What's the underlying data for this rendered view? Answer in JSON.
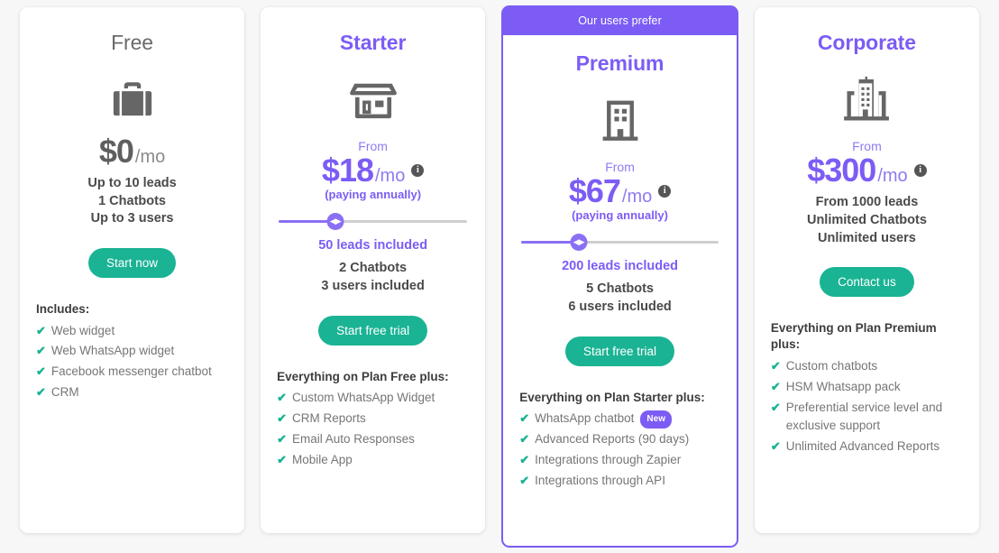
{
  "colors": {
    "purple": "#7c5cf5",
    "green": "#1ab394",
    "gray_text": "#767676",
    "page_bg": "#f7f7f7"
  },
  "plans": [
    {
      "name": "Free",
      "icon": "briefcase-icon",
      "from_label": "",
      "price_amount": "$0",
      "price_period": "/mo",
      "annually_note": "",
      "has_info_icon": false,
      "has_slider": false,
      "leads_included": "",
      "specs": [
        "Up to 10 leads",
        "1 Chatbots",
        "Up to 3 users"
      ],
      "cta_label": "Start now",
      "features_heading": "Includes:",
      "features": [
        {
          "text": "Web widget",
          "badge": ""
        },
        {
          "text": "Web WhatsApp widget",
          "badge": ""
        },
        {
          "text": "Facebook messenger chatbot",
          "badge": ""
        },
        {
          "text": "CRM",
          "badge": ""
        }
      ]
    },
    {
      "name": "Starter",
      "icon": "storefront-icon",
      "from_label": "From",
      "price_amount": "$18",
      "price_period": "/mo",
      "annually_note": "(paying annually)",
      "has_info_icon": true,
      "has_slider": true,
      "slider_percent": 30,
      "leads_included": "50 leads included",
      "specs": [
        "2 Chatbots",
        "3 users included"
      ],
      "cta_label": "Start free trial",
      "features_heading": "Everything on Plan Free plus:",
      "features": [
        {
          "text": "Custom WhatsApp Widget",
          "badge": ""
        },
        {
          "text": "CRM Reports",
          "badge": ""
        },
        {
          "text": "Email Auto Responses",
          "badge": ""
        },
        {
          "text": "Mobile App",
          "badge": ""
        }
      ]
    },
    {
      "name": "Premium",
      "ribbon_label": "Our users prefer",
      "icon": "office-building-icon",
      "from_label": "From",
      "price_amount": "$67",
      "price_period": "/mo",
      "annually_note": "(paying annually)",
      "has_info_icon": true,
      "has_slider": true,
      "slider_percent": 29,
      "leads_included": "200 leads included",
      "specs": [
        "5 Chatbots",
        "6 users included"
      ],
      "cta_label": "Start free trial",
      "features_heading": "Everything on Plan Starter plus:",
      "features": [
        {
          "text": "WhatsApp chatbot",
          "badge": "New"
        },
        {
          "text": "Advanced Reports (90 days)",
          "badge": ""
        },
        {
          "text": "Integrations through Zapier",
          "badge": ""
        },
        {
          "text": "Integrations through API",
          "badge": ""
        }
      ]
    },
    {
      "name": "Corporate",
      "icon": "city-buildings-icon",
      "from_label": "From",
      "price_amount": "$300",
      "price_period": "/mo",
      "annually_note": "",
      "has_info_icon": true,
      "has_slider": false,
      "leads_included": "",
      "specs": [
        "From 1000 leads",
        "Unlimited Chatbots",
        "Unlimited users"
      ],
      "cta_label": "Contact us",
      "features_heading": "Everything on Plan Premium plus:",
      "features": [
        {
          "text": "Custom chatbots",
          "badge": ""
        },
        {
          "text": "HSM Whatsapp pack",
          "badge": ""
        },
        {
          "text": "Preferential service level and exclusive support",
          "badge": ""
        },
        {
          "text": "Unlimited Advanced Reports",
          "badge": ""
        }
      ]
    }
  ]
}
